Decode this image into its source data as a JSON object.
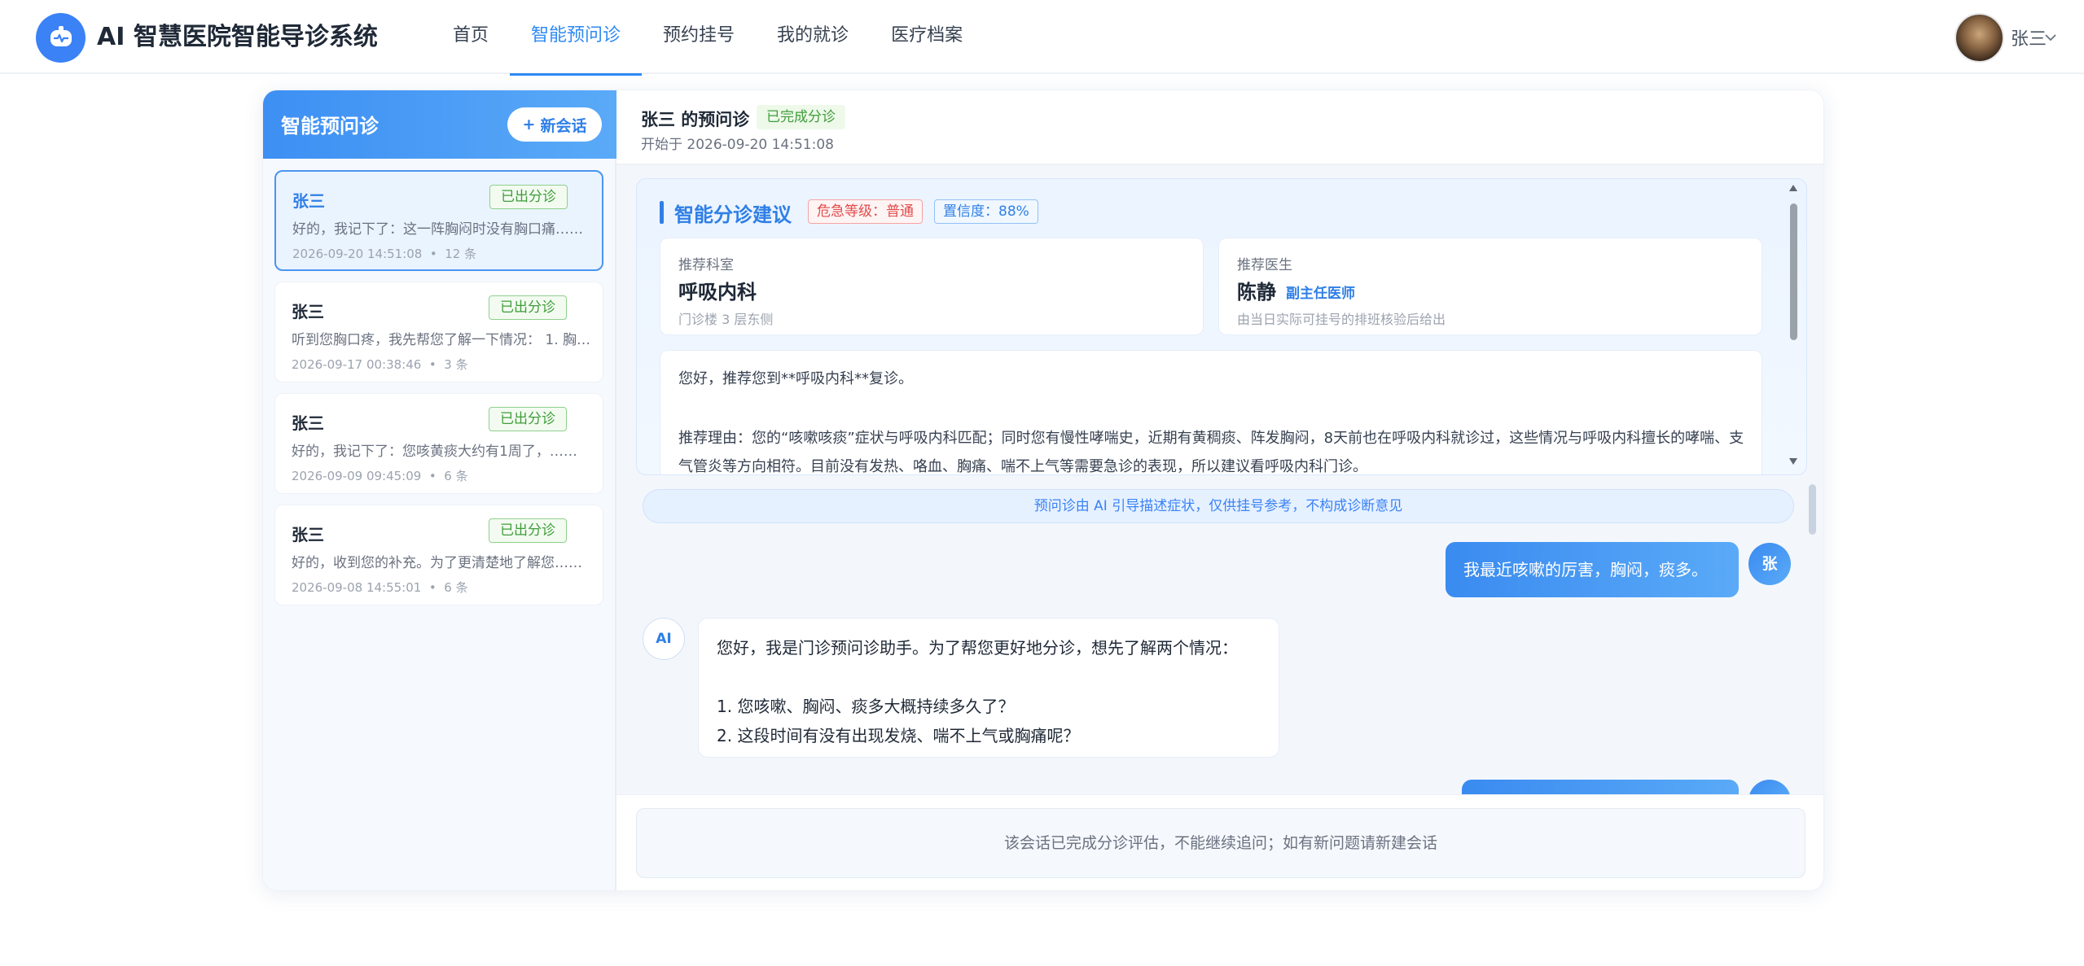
{
  "header": {
    "app_title": "AI 智慧医院智能导诊系统",
    "nav": [
      {
        "label": "首页",
        "active": false
      },
      {
        "label": "智能预问诊",
        "active": true
      },
      {
        "label": "预约挂号",
        "active": false
      },
      {
        "label": "我的就诊",
        "active": false
      },
      {
        "label": "医疗档案",
        "active": false
      }
    ],
    "user_name": "张三",
    "icons": {
      "logo": "robot-icon",
      "user_menu": "chevron-down-icon"
    }
  },
  "sidebar": {
    "title": "智能预问诊",
    "new_button": {
      "icon": "+",
      "label": "新会话"
    },
    "sessions": [
      {
        "name": "张三",
        "badge": "已出分诊",
        "preview": "好的，我记下了：这一阵胸闷时没有胸口痛……",
        "time": "2026-09-20 14:51:08",
        "count": "12 条",
        "active": true
      },
      {
        "name": "张三",
        "badge": "已出分诊",
        "preview": "听到您胸口疼，我先帮您了解一下情况： 1. 胸口…",
        "time": "2026-09-17 00:38:46",
        "count": "3 条",
        "active": false
      },
      {
        "name": "张三",
        "badge": "已出分诊",
        "preview": "好的，我记下了：您咳黄痰大约有1周了，……",
        "time": "2026-09-09 09:45:09",
        "count": "6 条",
        "active": false
      },
      {
        "name": "张三",
        "badge": "已出分诊",
        "preview": "好的，收到您的补充。为了更清楚地了解您……",
        "time": "2026-09-08 14:55:01",
        "count": "6 条",
        "active": false
      }
    ],
    "meta_separator": "•"
  },
  "conversation": {
    "title": "张三 的预问诊",
    "status": "已完成分诊",
    "started_at": "开始于 2026-09-20 14:51:08",
    "triage": {
      "title": "智能分诊建议",
      "danger_level": "危急等级：普通",
      "confidence": "置信度：88%",
      "department": {
        "label": "推荐科室",
        "value": "呼吸内科",
        "sub": "门诊楼 3 层东侧"
      },
      "doctor": {
        "label": "推荐医生",
        "name": "陈静",
        "rank": "副主任医师",
        "sub": "由当日实际可挂号的排班核验后给出"
      },
      "recommend_line": "您好，推荐您到**呼吸内科**复诊。",
      "reason": "推荐理由：您的“咳嗽咳痰”症状与呼吸内科匹配；同时您有慢性哮喘史，近期有黄稠痰、阵发胸闷，8天前也在呼吸内科就诊过，这些情况与呼吸内科擅长的哮喘、支气管炎等方向相符。目前没有发热、咯血、胸痛、喘不上气等需要急诊的表现，所以建议看呼吸内科门诊。"
    },
    "disclaimer": "预问诊由 AI 引导描述症状，仅供挂号参考，不构成诊断意见",
    "messages": {
      "user_avatar": "张",
      "ai_avatar": "AI",
      "user_1": "我最近咳嗽的厉害，胸闷，痰多。",
      "ai_intro": "您好，我是门诊预问诊助手。为了帮您更好地分诊，想先了解两个情况：",
      "ai_q1": "1. 您咳嗽、胸闷、痰多大概持续多久了？",
      "ai_q2": "2. 这段时间有没有出现发烧、喘不上气或胸痛呢？"
    },
    "footer_notice": "该会话已完成分诊评估，不能继续追问；如有新问题请新建会话"
  },
  "colors": {
    "primary": "#2f7fe6",
    "success": "#3f9d3a",
    "danger": "#e24b4b"
  }
}
